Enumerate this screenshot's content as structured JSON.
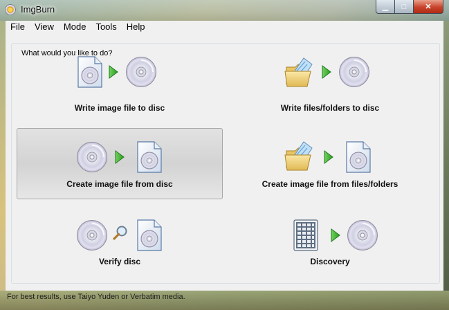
{
  "window": {
    "title": "ImgBurn"
  },
  "menu": [
    "File",
    "View",
    "Mode",
    "Tools",
    "Help"
  ],
  "group_label": "What would you like to do?",
  "tiles": [
    {
      "label": "Write image file to disc",
      "icons": [
        "image-file-icon",
        "play-arrow-icon",
        "disc-icon"
      ]
    },
    {
      "label": "Write files/folders to disc",
      "icons": [
        "folder-icon",
        "play-arrow-icon",
        "disc-icon"
      ]
    },
    {
      "label": "Create image file from disc",
      "icons": [
        "disc-icon",
        "play-arrow-icon",
        "image-file-icon"
      ]
    },
    {
      "label": "Create image file from files/folders",
      "icons": [
        "folder-icon",
        "play-arrow-icon",
        "image-file-icon"
      ]
    },
    {
      "label": "Verify disc",
      "icons": [
        "disc-icon",
        "magnifier-icon",
        "image-file-icon"
      ]
    },
    {
      "label": "Discovery",
      "icons": [
        "calculator-icon",
        "play-arrow-icon",
        "disc-icon"
      ]
    }
  ],
  "status": "For best results, use Taiyo Yuden or Verbatim media."
}
